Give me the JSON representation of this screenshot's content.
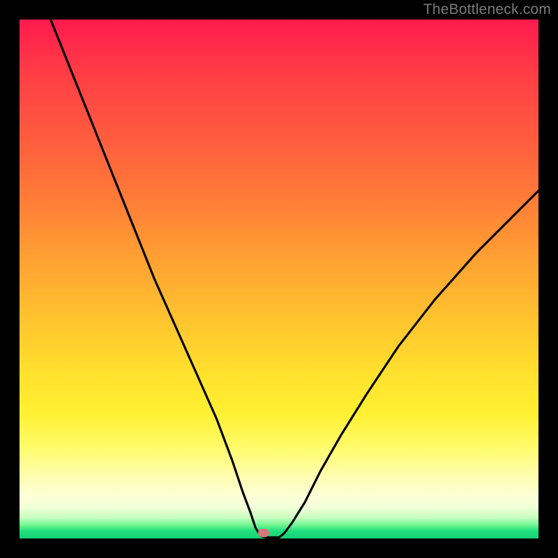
{
  "watermark": "TheBottleneck.com",
  "chart_data": {
    "type": "line",
    "title": "",
    "xlabel": "",
    "ylabel": "",
    "xlim": [
      0,
      100
    ],
    "ylim": [
      0,
      100
    ],
    "grid": false,
    "legend": false,
    "background_gradient": {
      "direction": "vertical",
      "stops": [
        {
          "pos": 0.0,
          "color": "#ff1a4d"
        },
        {
          "pos": 0.5,
          "color": "#ffb030"
        },
        {
          "pos": 0.8,
          "color": "#fffb66"
        },
        {
          "pos": 0.95,
          "color": "#c8ffbf"
        },
        {
          "pos": 1.0,
          "color": "#14d176"
        }
      ]
    },
    "series": [
      {
        "name": "bottleneck-curve",
        "color": "#000000",
        "x": [
          6,
          10,
          14,
          18,
          22,
          26,
          30,
          34,
          38,
          41,
          43,
          44.5,
          45.5,
          46.5,
          47.5,
          49,
          50,
          51,
          52.5,
          55,
          58,
          62,
          67,
          73,
          80,
          88,
          96,
          100
        ],
        "y": [
          100,
          90,
          80,
          70,
          60,
          50,
          41,
          32,
          23,
          15,
          9,
          5,
          2,
          0.5,
          0.2,
          0.2,
          0.2,
          1,
          3,
          7,
          13,
          20,
          28,
          37,
          46,
          55,
          63,
          67
        ]
      }
    ],
    "marker": {
      "name": "optimal-point",
      "x": 47,
      "y": 0.3,
      "color": "#d77878",
      "shape": "rounded-rect"
    }
  }
}
